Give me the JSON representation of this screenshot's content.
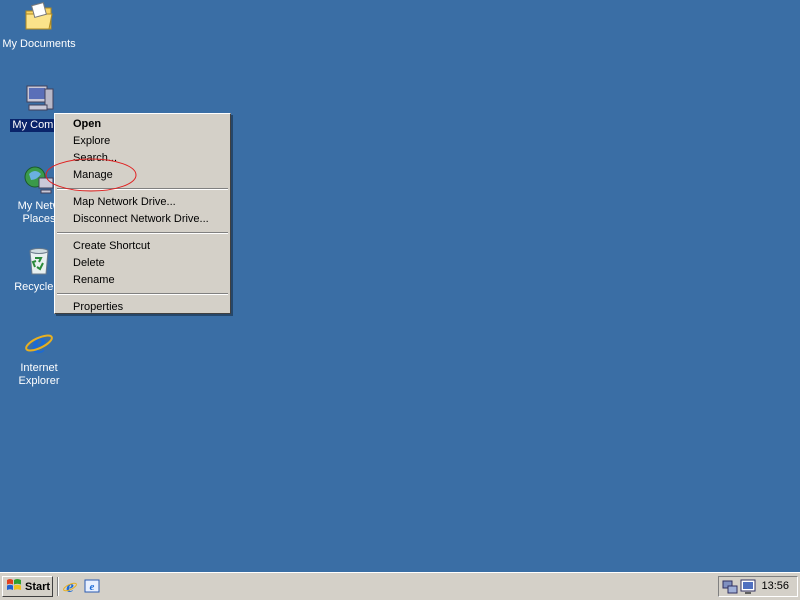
{
  "desktop": {
    "background_color": "#3a6ea5",
    "icons": [
      {
        "label": "My Documents",
        "icon": "folder-documents-icon"
      },
      {
        "label": "My Compu",
        "icon": "computer-icon"
      },
      {
        "label": "My Netw",
        "label2": "Places",
        "icon": "network-places-icon"
      },
      {
        "label": "Recycle B",
        "icon": "recycle-bin-icon"
      },
      {
        "label": "Internet",
        "label2": "Explorer",
        "icon": "internet-explorer-icon"
      }
    ]
  },
  "context_menu": {
    "items": [
      {
        "label": "Open"
      },
      {
        "label": "Explore"
      },
      {
        "label": "Search..."
      },
      {
        "label": "Manage"
      },
      {
        "label": "Map Network Drive..."
      },
      {
        "label": "Disconnect Network Drive..."
      },
      {
        "label": "Create Shortcut"
      },
      {
        "label": "Delete"
      },
      {
        "label": "Rename"
      },
      {
        "label": "Properties"
      }
    ],
    "annotation_color": "#e02020"
  },
  "taskbar": {
    "start_label": "Start",
    "quick_launch": [
      "internet-explorer-icon",
      "outlook-express-icon"
    ],
    "tray_icons": [
      "network-connection-icon",
      "display-icon"
    ],
    "clock": "13:56"
  }
}
